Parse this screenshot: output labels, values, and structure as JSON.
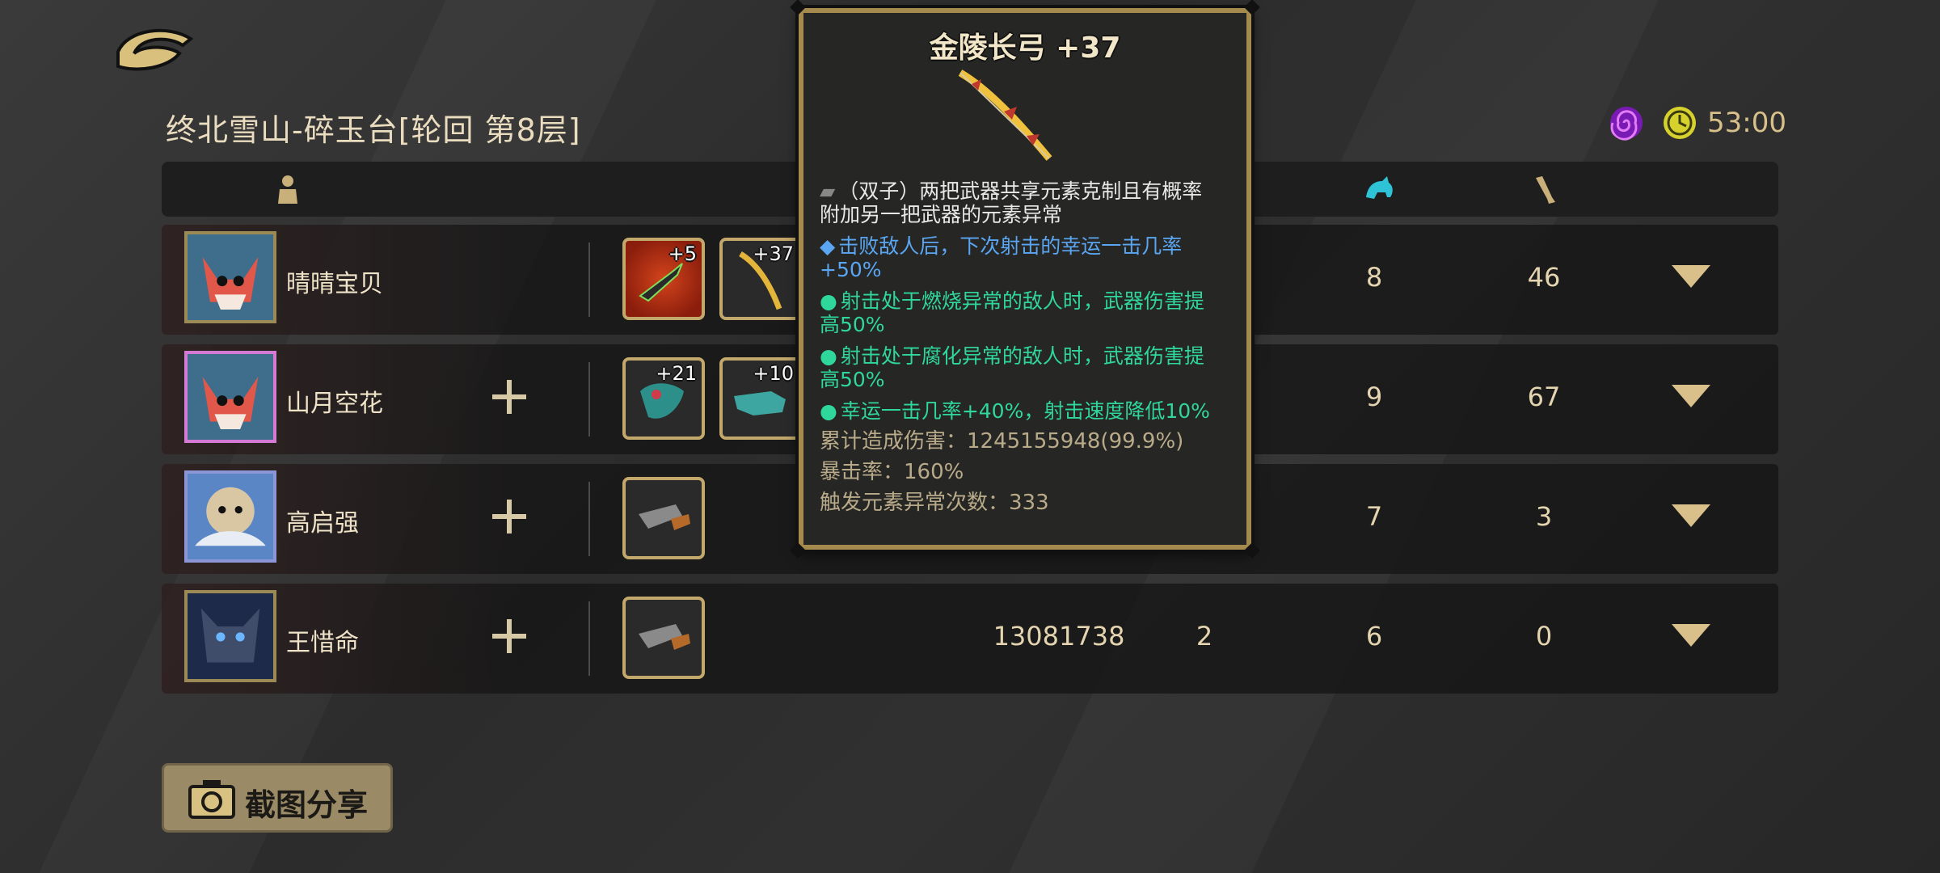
{
  "location_title": "终北雪山-碎玉台[轮回  第8层]",
  "timer": "53:00",
  "players": [
    {
      "name": "晴晴宝贝",
      "weapons": [
        {
          "level": "+5",
          "color": "red"
        },
        {
          "level": "+37",
          "color": "gold"
        }
      ],
      "col_a": "",
      "col_b": "",
      "col_c": "8",
      "col_d": "46"
    },
    {
      "name": "山月空花",
      "weapons": [
        {
          "level": "+21"
        },
        {
          "level": "+10"
        }
      ],
      "col_a": "",
      "col_b": "",
      "col_c": "9",
      "col_d": "67"
    },
    {
      "name": "高启强",
      "weapons": [
        {
          "level": ""
        }
      ],
      "col_a": "",
      "col_b": "",
      "col_c": "7",
      "col_d": "3"
    },
    {
      "name": "王惜命",
      "weapons": [
        {
          "level": ""
        }
      ],
      "col_a": "13081738",
      "col_b": "2",
      "col_c": "6",
      "col_d": "0"
    }
  ],
  "screenshot_button": "截图分享",
  "tooltip": {
    "title": "金陵长弓 +37",
    "desc_line1": "（双子）两把武器共享元素克制且有概率",
    "desc_line2": "附加另一把武器的元素异常",
    "blue_line1": "击败敌人后，下次射击的幸运一击几率",
    "blue_line2": "+50%",
    "green1_line1": "射击处于燃烧异常的敌人时，武器伤害提",
    "green1_line2": "高50%",
    "green2_line1": "射击处于腐化异常的敌人时，武器伤害提",
    "green2_line2": "高50%",
    "green3_line1": "幸运一击几率+40%，射击速度降低10%",
    "stat_damage": "累计造成伤害：1245155948(99.9%)",
    "stat_crit": "暴击率：160%",
    "stat_trigger": "触发元素异常次数：333"
  },
  "colors": {
    "accent_gold": "#c3a86c",
    "tooltip_blue": "#5aa6f2",
    "tooltip_green": "#2fd79a"
  }
}
